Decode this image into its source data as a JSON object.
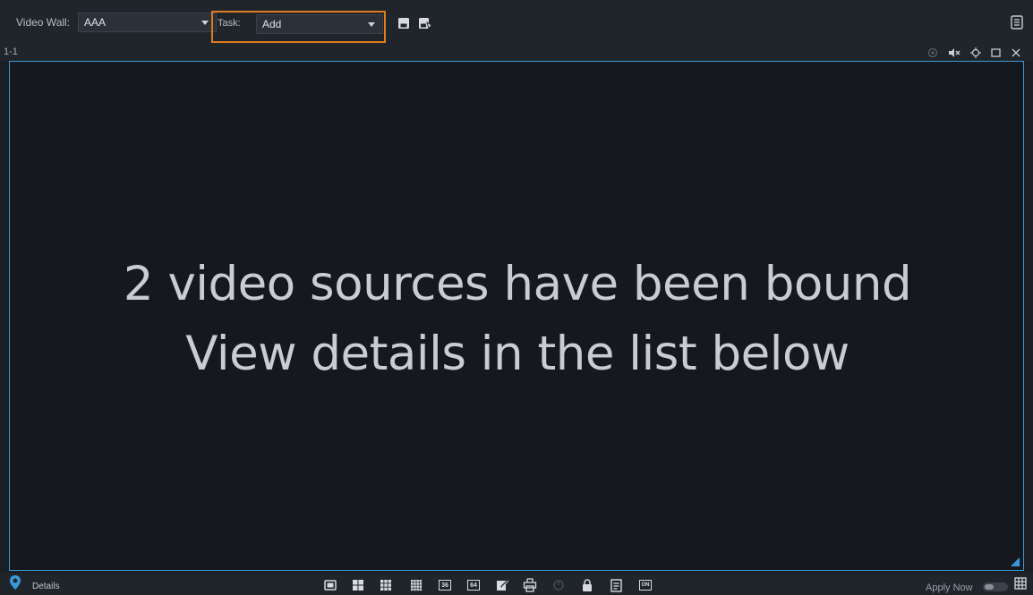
{
  "toolbar": {
    "video_wall_label": "Video Wall:",
    "video_wall_value": "AAA",
    "task_label": "Task:",
    "task_value": "Add",
    "save_icon": "save-icon",
    "save_as_icon": "save-as-icon",
    "list_icon": "list-icon"
  },
  "window": {
    "screen_id": "1-1",
    "controls": [
      "record-icon",
      "mute-icon",
      "target-icon",
      "maximize-icon",
      "close-icon"
    ]
  },
  "video": {
    "message_line1": "2 video sources have been bound",
    "message_line2": "View details in the list below"
  },
  "bottombar": {
    "details_label": "Details",
    "layout_36": "36",
    "layout_64": "64",
    "on_badge": "ON",
    "apply_now_label": "Apply Now",
    "apply_now_enabled": false
  },
  "colors": {
    "accent": "#3a9ad9",
    "highlight": "#e07b1f",
    "background": "#15181c"
  }
}
